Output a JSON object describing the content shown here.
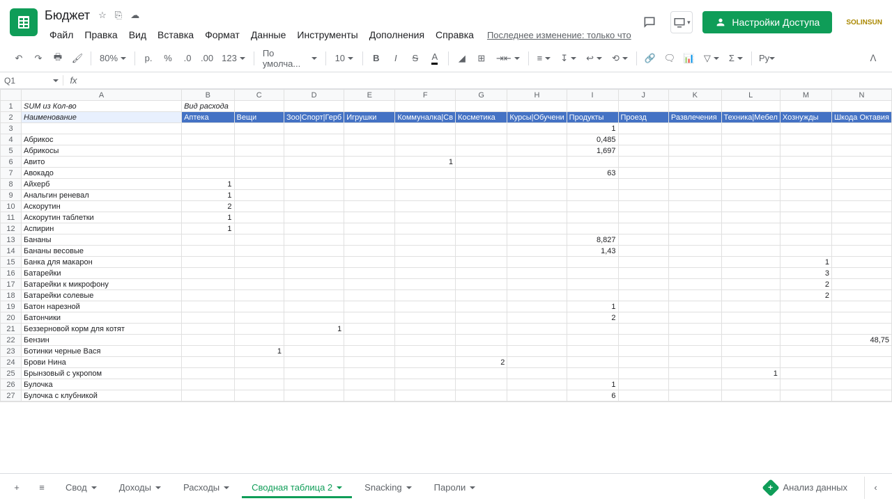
{
  "doc": {
    "title": "Бюджет",
    "last_edit": "Последнее изменение: только что"
  },
  "menus": [
    "Файл",
    "Правка",
    "Вид",
    "Вставка",
    "Формат",
    "Данные",
    "Инструменты",
    "Дополнения",
    "Справка"
  ],
  "share": {
    "label": "Настройки Доступа"
  },
  "brand": "SOLINSUN",
  "toolbar": {
    "zoom": "80%",
    "font": "По умолча...",
    "size": "10"
  },
  "name_box": "Q1",
  "columns": [
    "A",
    "B",
    "C",
    "D",
    "E",
    "F",
    "G",
    "H",
    "I",
    "J",
    "K",
    "L",
    "M",
    "N"
  ],
  "row1": {
    "a": "SUM из Кол-во",
    "b": "Вид расхода"
  },
  "headers2": [
    "Наименование",
    "Аптека",
    "Вещи",
    "Зоо|Спорт|Герб",
    "Игрушки",
    "Коммуналка|Св",
    "Косметика",
    "Курсы|Обучени",
    "Продукты",
    "Проезд",
    "Развлечения",
    "Техника|Мебел",
    "Хознужды",
    "Шкода Октавия"
  ],
  "rows": [
    {
      "n": 3,
      "a": "",
      "vals": [
        "",
        "",
        "",
        "",
        "",
        "",
        "",
        "1",
        "",
        "",
        "",
        "",
        ""
      ]
    },
    {
      "n": 4,
      "a": "Абрикос",
      "vals": [
        "",
        "",
        "",
        "",
        "",
        "",
        "",
        "0,485",
        "",
        "",
        "",
        "",
        ""
      ]
    },
    {
      "n": 5,
      "a": "Абрикосы",
      "vals": [
        "",
        "",
        "",
        "",
        "",
        "",
        "",
        "1,697",
        "",
        "",
        "",
        "",
        ""
      ]
    },
    {
      "n": 6,
      "a": "Авито",
      "vals": [
        "",
        "",
        "",
        "",
        "1",
        "",
        "",
        "",
        "",
        "",
        "",
        "",
        ""
      ]
    },
    {
      "n": 7,
      "a": "Авокадо",
      "vals": [
        "",
        "",
        "",
        "",
        "",
        "",
        "",
        "63",
        "",
        "",
        "",
        "",
        ""
      ]
    },
    {
      "n": 8,
      "a": "Айхерб",
      "vals": [
        "1",
        "",
        "",
        "",
        "",
        "",
        "",
        "",
        "",
        "",
        "",
        "",
        ""
      ]
    },
    {
      "n": 9,
      "a": "Анальгин реневал",
      "vals": [
        "1",
        "",
        "",
        "",
        "",
        "",
        "",
        "",
        "",
        "",
        "",
        "",
        ""
      ]
    },
    {
      "n": 10,
      "a": "Аскорутин",
      "vals": [
        "2",
        "",
        "",
        "",
        "",
        "",
        "",
        "",
        "",
        "",
        "",
        "",
        ""
      ]
    },
    {
      "n": 11,
      "a": "Аскорутин таблетки",
      "vals": [
        "1",
        "",
        "",
        "",
        "",
        "",
        "",
        "",
        "",
        "",
        "",
        "",
        ""
      ]
    },
    {
      "n": 12,
      "a": "Аспирин",
      "vals": [
        "1",
        "",
        "",
        "",
        "",
        "",
        "",
        "",
        "",
        "",
        "",
        "",
        ""
      ]
    },
    {
      "n": 13,
      "a": "Бананы",
      "vals": [
        "",
        "",
        "",
        "",
        "",
        "",
        "",
        "8,827",
        "",
        "",
        "",
        "",
        ""
      ]
    },
    {
      "n": 14,
      "a": "Бананы весовые",
      "vals": [
        "",
        "",
        "",
        "",
        "",
        "",
        "",
        "1,43",
        "",
        "",
        "",
        "",
        ""
      ]
    },
    {
      "n": 15,
      "a": "Банка для макарон",
      "vals": [
        "",
        "",
        "",
        "",
        "",
        "",
        "",
        "",
        "",
        "",
        "",
        "1",
        ""
      ]
    },
    {
      "n": 16,
      "a": "Батарейки",
      "vals": [
        "",
        "",
        "",
        "",
        "",
        "",
        "",
        "",
        "",
        "",
        "",
        "3",
        ""
      ]
    },
    {
      "n": 17,
      "a": "Батарейки к микрофону",
      "vals": [
        "",
        "",
        "",
        "",
        "",
        "",
        "",
        "",
        "",
        "",
        "",
        "2",
        ""
      ]
    },
    {
      "n": 18,
      "a": "Батарейки солевые",
      "vals": [
        "",
        "",
        "",
        "",
        "",
        "",
        "",
        "",
        "",
        "",
        "",
        "2",
        ""
      ]
    },
    {
      "n": 19,
      "a": "Батон нарезной",
      "vals": [
        "",
        "",
        "",
        "",
        "",
        "",
        "",
        "1",
        "",
        "",
        "",
        "",
        ""
      ]
    },
    {
      "n": 20,
      "a": "Батончики",
      "vals": [
        "",
        "",
        "",
        "",
        "",
        "",
        "",
        "2",
        "",
        "",
        "",
        "",
        ""
      ]
    },
    {
      "n": 21,
      "a": "Беззерновой корм для котят",
      "vals": [
        "",
        "",
        "1",
        "",
        "",
        "",
        "",
        "",
        "",
        "",
        "",
        "",
        ""
      ]
    },
    {
      "n": 22,
      "a": "Бензин",
      "vals": [
        "",
        "",
        "",
        "",
        "",
        "",
        "",
        "",
        "",
        "",
        "",
        "",
        "48,75"
      ]
    },
    {
      "n": 23,
      "a": "Ботинки черные Вася",
      "vals": [
        "",
        "1",
        "",
        "",
        "",
        "",
        "",
        "",
        "",
        "",
        "",
        "",
        ""
      ]
    },
    {
      "n": 24,
      "a": "Брови Нина",
      "vals": [
        "",
        "",
        "",
        "",
        "",
        "2",
        "",
        "",
        "",
        "",
        "",
        "",
        ""
      ]
    },
    {
      "n": 25,
      "a": "Брынзовый с укропом",
      "vals": [
        "",
        "",
        "",
        "",
        "",
        "",
        "",
        "",
        "",
        "",
        "1",
        "",
        ""
      ]
    },
    {
      "n": 26,
      "a": "Булочка",
      "vals": [
        "",
        "",
        "",
        "",
        "",
        "",
        "",
        "1",
        "",
        "",
        "",
        "",
        ""
      ]
    },
    {
      "n": 27,
      "a": "Булочка с клубникой",
      "vals": [
        "",
        "",
        "",
        "",
        "",
        "",
        "",
        "6",
        "",
        "",
        "",
        "",
        ""
      ]
    }
  ],
  "tabs": [
    "Свод",
    "Доходы",
    "Расходы",
    "Сводная таблица 2",
    "Snacking",
    "Пароли"
  ],
  "active_tab": 3,
  "explore": "Анализ данных"
}
